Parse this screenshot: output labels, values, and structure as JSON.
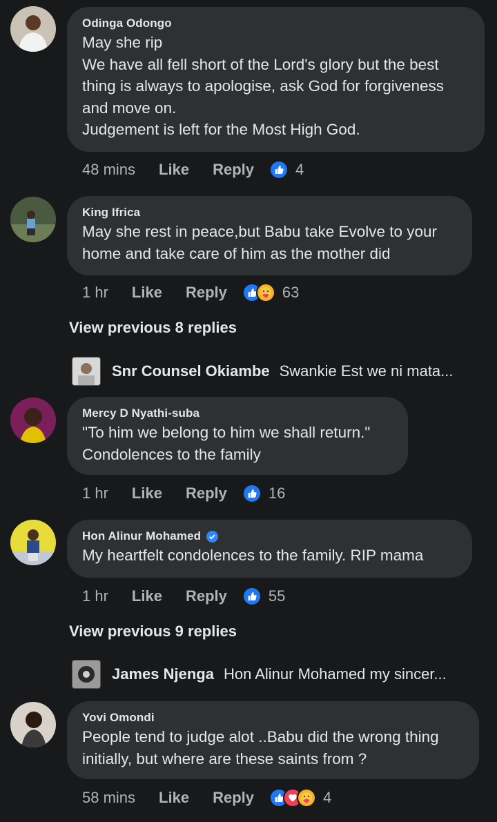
{
  "comments": [
    {
      "author": "Odinga Odongo",
      "text": "May she rip\nWe have all fell short of the Lord's glory but the best thing is always to apologise, ask God for forgiveness and move on.\nJudgement is left for the Most High God.",
      "time": "48 mins",
      "like": "Like",
      "reply": "Reply",
      "reactions": [
        "like"
      ],
      "count": "4"
    },
    {
      "author": "King Ifrica",
      "text": "May she rest in peace,but Babu take Evolve to your home and take care of him as the mother did",
      "time": "1 hr",
      "like": "Like",
      "reply": "Reply",
      "reactions": [
        "like",
        "care"
      ],
      "count": "63"
    },
    {
      "author": "Mercy D Nyathi-suba",
      "text": "\"To him we belong to him we shall return.\"\nCondolences to the family",
      "time": "1 hr",
      "like": "Like",
      "reply": "Reply",
      "reactions": [
        "like"
      ],
      "count": "16"
    },
    {
      "author": "Hon Alinur Mohamed",
      "verified": true,
      "text": " My heartfelt condolences to the family. RIP mama",
      "time": "1 hr",
      "like": "Like",
      "reply": "Reply",
      "reactions": [
        "like"
      ],
      "count": "55"
    },
    {
      "author": "Yovi Omondi",
      "text": "People tend to judge alot ..Babu did the wrong thing initially,  but where are these saints from ?",
      "time": "58 mins",
      "like": "Like",
      "reply": "Reply",
      "reactions": [
        "like",
        "love",
        "care"
      ],
      "count": "4"
    }
  ],
  "view_previous": [
    {
      "label": "View previous 8 replies"
    },
    {
      "label": "View previous 9 replies"
    }
  ],
  "reply_previews": [
    {
      "name": "Snr Counsel Okiambe",
      "text": "Swankie Est we ni mata..."
    },
    {
      "name": "James Njenga",
      "text": "Hon Alinur Mohamed my sincer..."
    }
  ],
  "colors": {
    "background": "#18191a",
    "bubble": "#2f3031",
    "like_blue": "#2078f4",
    "love_red": "#f33e58",
    "care_yellow": "#f7b125",
    "verified_blue": "#2d88ff"
  }
}
